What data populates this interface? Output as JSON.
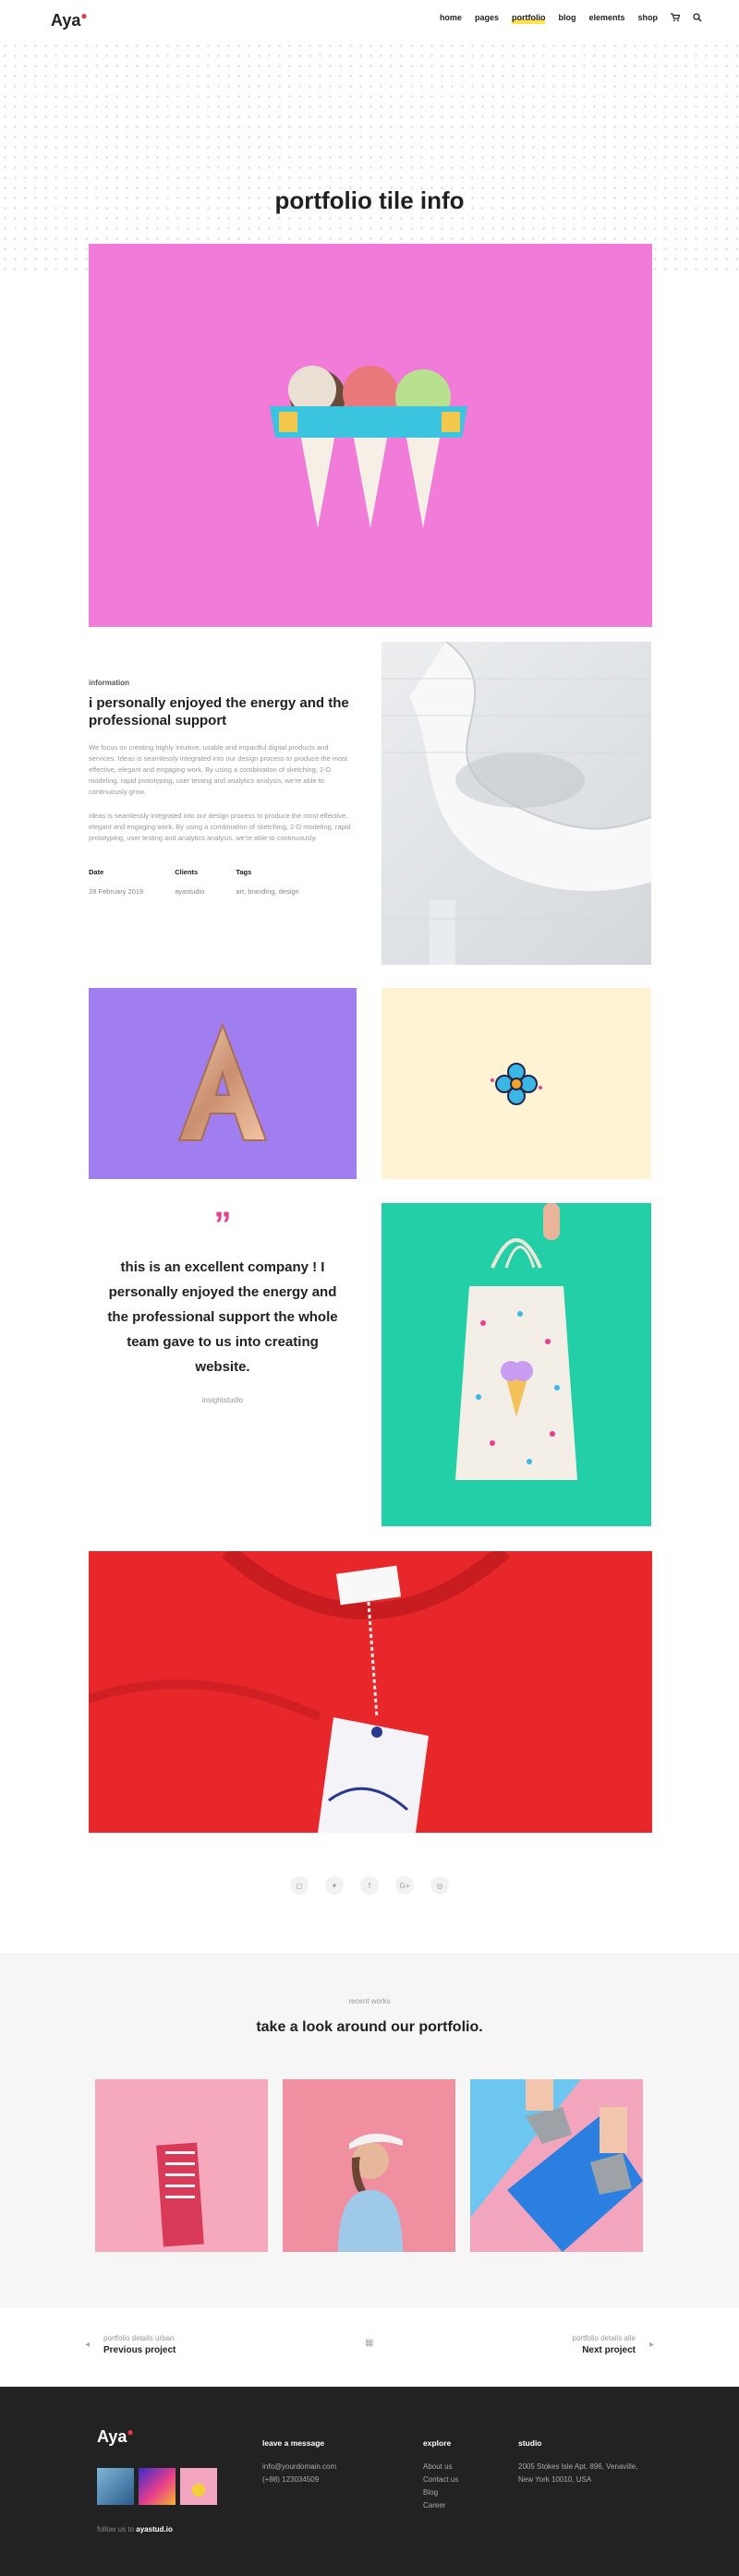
{
  "header": {
    "logo": "Aya",
    "nav": [
      "home",
      "pages",
      "portfolio",
      "blog",
      "elements",
      "shop"
    ],
    "active": "portfolio"
  },
  "hero": {
    "title": "portfolio tile info"
  },
  "info": {
    "label": "information",
    "heading": "i personally enjoyed the energy and the professional support",
    "para1": "We focus on creating highly intuitive, usable and impactful digital products and services. Ideas is seamlessly integrated into our design process to produce the most effective, elegant and engaging work. By using a combination of sketching, 2-D modeling, rapid prototyping, user testing and analytics analysis, we're able to continuously grow.",
    "para2": "Ideas is seamlessly integrated into our design process to produce the most effective, elegant and engaging work. By using a combination of sketching, 2-D modeling, rapid prototyping, user testing and analytics analysis, we're able to continuously.",
    "meta": [
      {
        "key": "Date",
        "value": "28 February 2019"
      },
      {
        "key": "Clients",
        "value": "ayastudio"
      },
      {
        "key": "Tags",
        "value": "art, branding, design"
      }
    ]
  },
  "quote": {
    "mark": "”",
    "text": "this is an excellent company ! I personally enjoyed the energy and the professional support the whole team gave to us into creating website.",
    "author": "insightstudio"
  },
  "social": [
    "◻",
    "✦",
    "f",
    "G+",
    "◎"
  ],
  "recent": {
    "sub": "recent works",
    "title": "take a look around our portfolio."
  },
  "prevnext": {
    "prev_sub": "portfolio details urban",
    "prev_label": "Previous project",
    "next_sub": "portfolio details alle",
    "next_label": "Next project"
  },
  "footer": {
    "logo": "Aya",
    "follow_text": "follow us to",
    "follow_handle": "ayastud.io",
    "col1_title": "leave a message",
    "col1_lines": [
      "info@yourdomain.com",
      "(+88) 123034509"
    ],
    "col2_title": "explore",
    "col2_lines": [
      "About us",
      "Contact us",
      "Blog",
      "Career"
    ],
    "col3_title": "studio",
    "col3_lines": [
      "2005 Stokes Isle Apt. 896, Venaville,",
      "New York 10010, USA"
    ]
  },
  "colors": {
    "accent": "#e83e8c",
    "pink_tile": "#f07bd8",
    "purple_tile": "#a07ef0",
    "green_tile": "#22cfa6",
    "red_tile": "#e8272a"
  }
}
